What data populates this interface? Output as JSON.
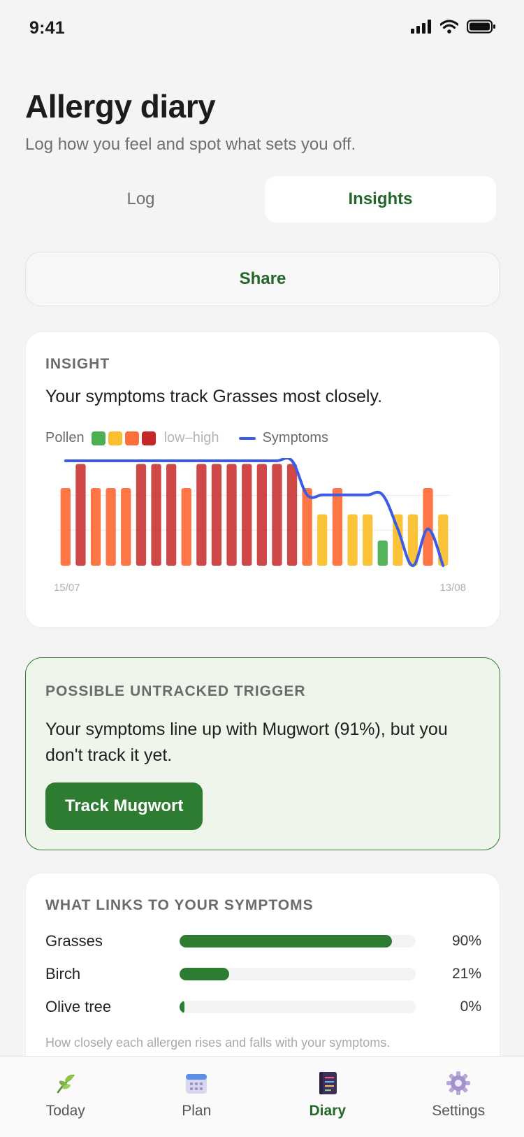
{
  "status_bar": {
    "time": "9:41"
  },
  "header": {
    "title": "Allergy diary",
    "subtitle": "Log how you feel and spot what sets you off."
  },
  "segments": [
    {
      "label": "Log",
      "active": false
    },
    {
      "label": "Insights",
      "active": true
    }
  ],
  "share_label": "Share",
  "insight_card": {
    "label": "INSIGHT",
    "text": "Your symptoms track Grasses most closely.",
    "legend": {
      "pollen_label": "Pollen",
      "range_label": "low–high",
      "symptoms_label": "Symptoms"
    }
  },
  "colors": {
    "accent": "#2e7b32",
    "pollen_low": "#4caf50",
    "pollen_moderate": "#fbc02d",
    "pollen_high": "#ff6f3c",
    "pollen_very_high": "#c62828",
    "symptoms_line": "#3c5ce6"
  },
  "chart_data": {
    "type": "bar",
    "x_start_label": "15/07",
    "x_end_label": "13/08",
    "pollen_levels": [
      3,
      4,
      3,
      3,
      3,
      4,
      4,
      4,
      3,
      4,
      4,
      4,
      4,
      4,
      4,
      4,
      3,
      2,
      3,
      2,
      2,
      1,
      2,
      2,
      3,
      2
    ],
    "symptoms": [
      4,
      4,
      4,
      4,
      4,
      4,
      4,
      4,
      4,
      4,
      4,
      4,
      4,
      4,
      4,
      4,
      2.7,
      2.7,
      2.7,
      2.7,
      2.7,
      2.7,
      1.4,
      0,
      1.4,
      0
    ],
    "ylim": [
      0,
      4
    ]
  },
  "trigger_card": {
    "label": "POSSIBLE UNTRACKED TRIGGER",
    "text": "Your symptoms line up with Mugwort (91%), but you don't track it yet.",
    "button_label": "Track Mugwort"
  },
  "links_card": {
    "label": "WHAT LINKS TO YOUR SYMPTOMS",
    "rows": [
      {
        "name": "Grasses",
        "value": 90,
        "display": "90%"
      },
      {
        "name": "Birch",
        "value": 21,
        "display": "21%"
      },
      {
        "name": "Olive tree",
        "value": 0,
        "display": "0%"
      }
    ],
    "note": "How closely each allergen rises and falls with your symptoms."
  },
  "tabbar": [
    {
      "label": "Today",
      "icon": "leaf-icon",
      "active": false
    },
    {
      "label": "Plan",
      "icon": "calendar-icon",
      "active": false
    },
    {
      "label": "Diary",
      "icon": "notebook-icon",
      "active": true
    },
    {
      "label": "Settings",
      "icon": "gear-icon",
      "active": false
    }
  ]
}
